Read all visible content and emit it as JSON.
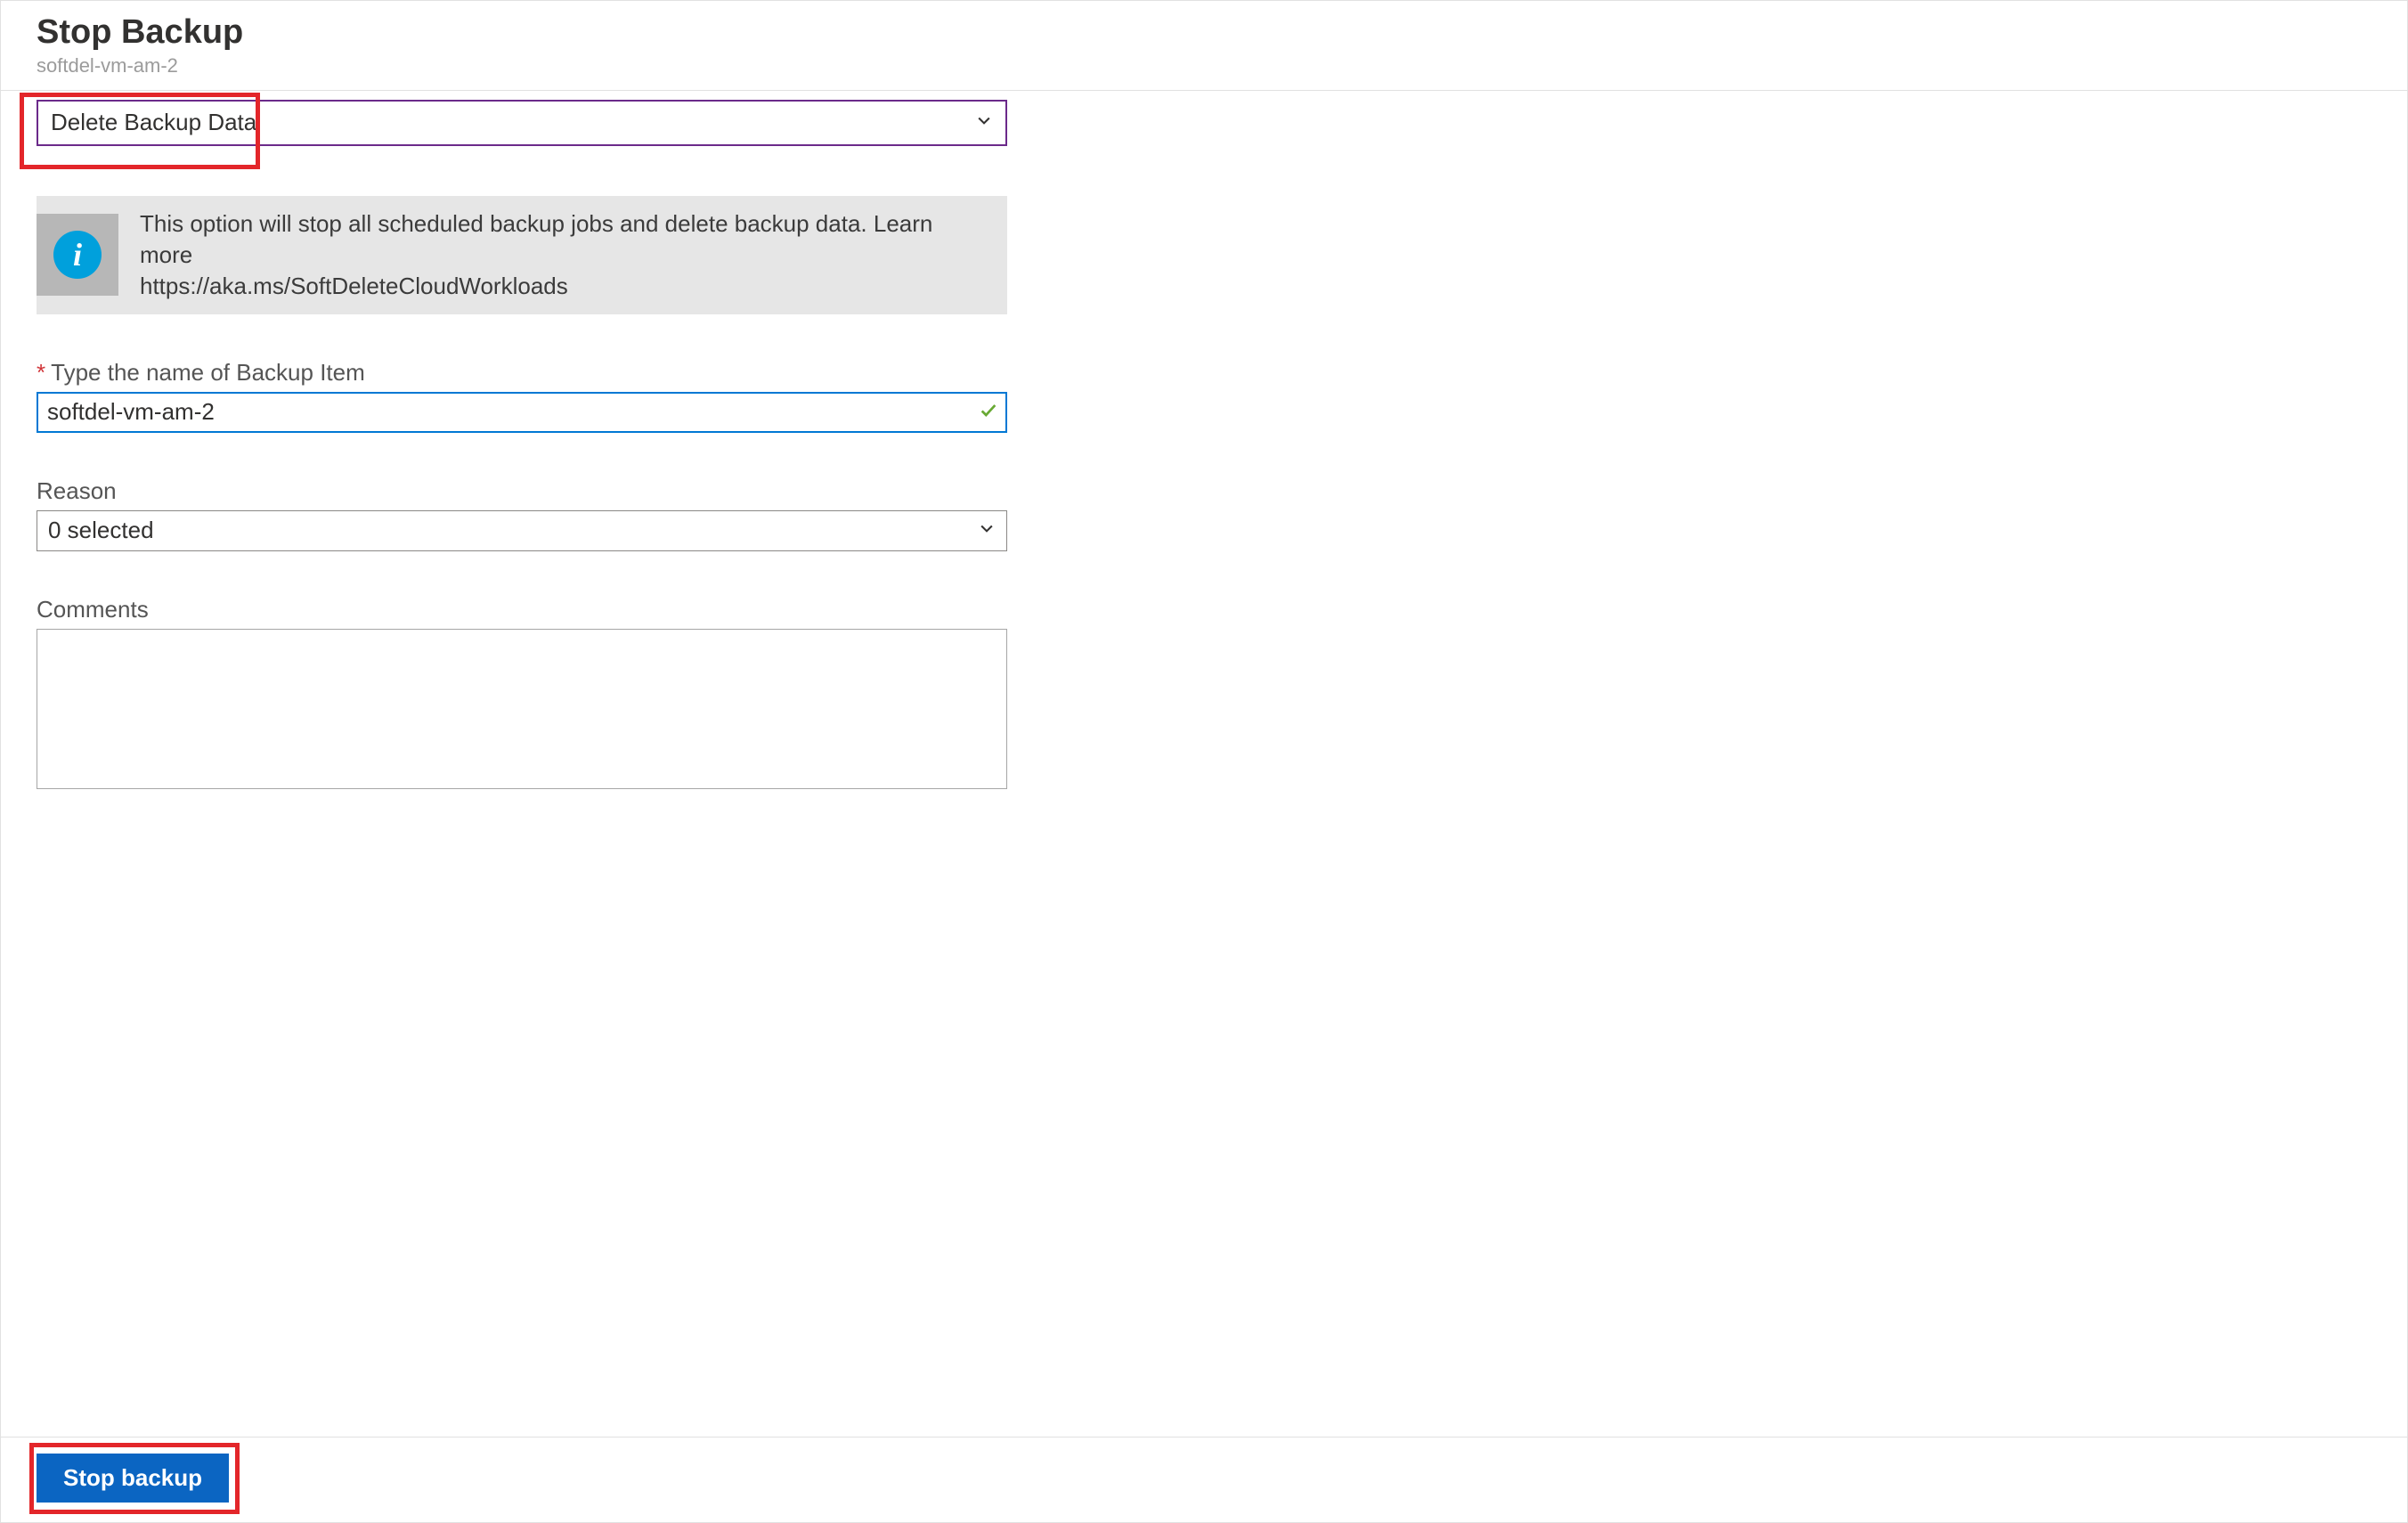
{
  "header": {
    "title": "Stop Backup",
    "subtitle": "softdel-vm-am-2"
  },
  "action_dropdown": {
    "selected": "Delete Backup Data"
  },
  "info": {
    "line1": "This option will stop all scheduled backup jobs and delete backup data. Learn more",
    "line2": "https://aka.ms/SoftDeleteCloudWorkloads"
  },
  "name_field": {
    "label": "Type the name of Backup Item",
    "value": "softdel-vm-am-2"
  },
  "reason_field": {
    "label": "Reason",
    "selected": "0 selected"
  },
  "comments_field": {
    "label": "Comments",
    "value": ""
  },
  "footer": {
    "stop_label": "Stop backup"
  }
}
